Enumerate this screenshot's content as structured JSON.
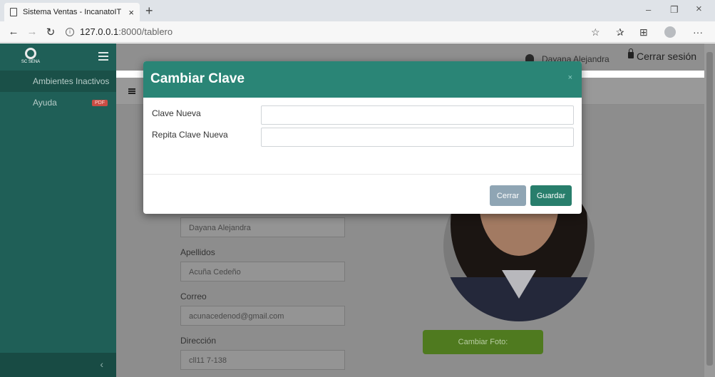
{
  "browser": {
    "tab_title": "Sistema Ventas - IncanatoIT",
    "tab_close": "×",
    "new_tab": "+",
    "url_host": "127.0.0.1",
    "url_path": ":8000/tablero",
    "minimize": "–",
    "restore": "❐",
    "close": "×",
    "back": "←",
    "forward": "→",
    "refresh": "↻",
    "info": "i",
    "favorite": "☆",
    "favorites_list": "✰",
    "collections": "⊞",
    "more": "···"
  },
  "sidebar": {
    "logo_text": "SC SENA",
    "items": [
      {
        "label": "Ambientes Inactivos"
      },
      {
        "label": "Ayuda",
        "badge": "PDF"
      }
    ],
    "collapse_icon": "‹"
  },
  "header": {
    "user_name": "Dayana Alejandra",
    "logout_label": "Cerrar sesión"
  },
  "profile": {
    "nombre_value": "Dayana Alejandra",
    "apellidos_label": "Apellidos",
    "apellidos_value": "Acuña Cedeño",
    "correo_label": "Correo",
    "correo_value": "acunacedenod@gmail.com",
    "direccion_label": "Dirección",
    "direccion_value": "cll11 7-138",
    "change_photo_label": "Cambiar Foto:"
  },
  "modal": {
    "title": "Cambiar Clave",
    "close_icon": "×",
    "new_password_label": "Clave Nueva",
    "repeat_password_label": "Repita Clave Nueva",
    "new_password_value": "",
    "repeat_password_value": "",
    "cancel_label": "Cerrar",
    "save_label": "Guardar"
  }
}
